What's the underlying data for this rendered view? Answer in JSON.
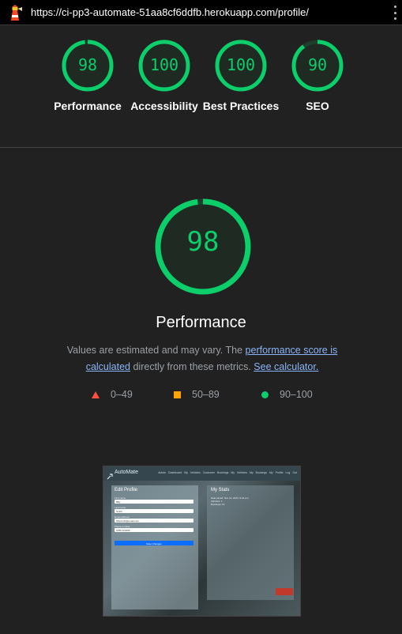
{
  "topbar": {
    "url": "https://ci-pp3-automate-51aa8cf6ddfb.herokuapp.com/profile/",
    "logo_icon": "lighthouse-icon",
    "menu_icon": "kebab-menu-icon"
  },
  "gauges": [
    {
      "score": "98",
      "label": "Performance",
      "value": 98
    },
    {
      "score": "100",
      "label": "Accessibility",
      "value": 100
    },
    {
      "score": "100",
      "label": "Best Practices",
      "value": 100
    },
    {
      "score": "90",
      "label": "SEO",
      "value": 90
    }
  ],
  "main": {
    "score": "98",
    "value": 98,
    "title": "Performance",
    "desc_pre": "Values are estimated and may vary. The ",
    "desc_link1": "performance score is calculated",
    "desc_mid": " directly from these metrics. ",
    "desc_link2": "See calculator."
  },
  "legend": {
    "fail": "0–49",
    "average": "50–89",
    "pass": "90–100"
  },
  "colors": {
    "pass": "#0cce6b",
    "average": "#ffa400",
    "fail": "#ff4e42",
    "link": "#8ab4f8",
    "background": "#212121"
  },
  "screenshot": {
    "brand": "AutoMate",
    "nav_links": "Admin Dashboard  My Vehicles  Customer Bookings  My Vehicles  My Bookings  My Profile  Log Out",
    "edit_title": "Edit Profile",
    "fields": [
      "First name",
      "Last name",
      "Email address",
      "Phone number"
    ],
    "field_values": [
      "Billy",
      "Smith",
      "billysmith@email.com",
      "0789 123456"
    ],
    "save_button": "Save Changes",
    "stats_title": "My Stats",
    "stats": [
      "Date joined: Nov 10, 2024, 9:44 a.m.",
      "Vehicles: 1",
      "Bookings: 10"
    ]
  }
}
